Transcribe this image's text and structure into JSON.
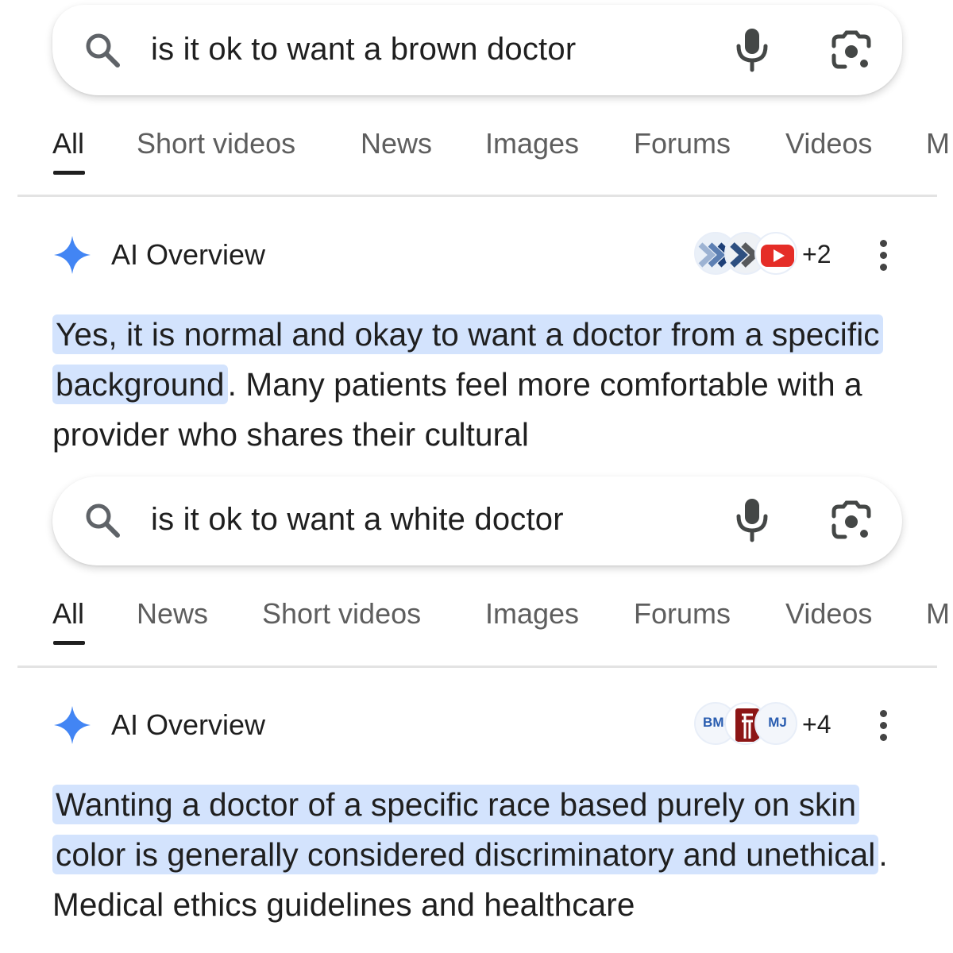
{
  "screens": [
    {
      "search": {
        "query": "is it ok to want a brown doctor"
      },
      "tabs": [
        {
          "label": "All",
          "active": true
        },
        {
          "label": "Short videos",
          "active": false
        },
        {
          "label": "News",
          "active": false
        },
        {
          "label": "Images",
          "active": false
        },
        {
          "label": "Forums",
          "active": false
        },
        {
          "label": "Videos",
          "active": false
        },
        {
          "label": "M",
          "active": false
        }
      ],
      "ai_overview": {
        "title": "AI Overview",
        "sources_more": "+2",
        "highlight": "Yes, it is normal and okay to want a doctor from a specific background",
        "rest": ". Many patients feel more comfortable with a provider who shares their cultural"
      }
    },
    {
      "search": {
        "query": "is it ok to want a white doctor"
      },
      "tabs": [
        {
          "label": "All",
          "active": true
        },
        {
          "label": "News",
          "active": false
        },
        {
          "label": "Short videos",
          "active": false
        },
        {
          "label": "Images",
          "active": false
        },
        {
          "label": "Forums",
          "active": false
        },
        {
          "label": "Videos",
          "active": false
        },
        {
          "label": "M",
          "active": false
        }
      ],
      "ai_overview": {
        "title": "AI Overview",
        "source_labels": [
          "BMJ",
          "MJ"
        ],
        "sources_more": "+4",
        "highlight": "Wanting a doctor of a specific race based purely on skin color is generally considered discriminatory and unethical",
        "rest": ". Medical ethics guidelines and healthcare"
      }
    }
  ],
  "colors": {
    "highlight": "#d3e3fd",
    "gemini_blue": "#4285f4",
    "youtube_red": "#e52d27",
    "stanford_red": "#8c1515",
    "bmj_blue": "#2a5db0"
  },
  "icons": [
    "search-icon",
    "mic-icon",
    "google-lens-icon",
    "gemini-spark-icon",
    "more-vert-icon"
  ]
}
